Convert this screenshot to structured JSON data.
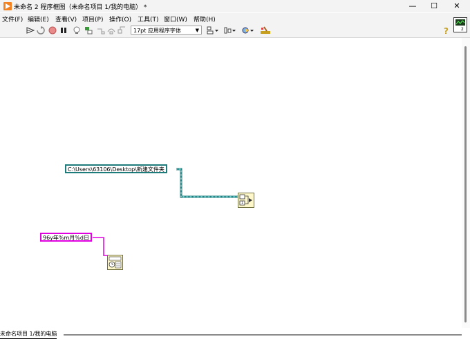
{
  "window": {
    "title": "未命名 2 程序框图（未命名项目 1/我的电脑）  *",
    "controls": {
      "minimize": "—",
      "maximize": "☐",
      "close": "✕"
    }
  },
  "menu": {
    "items": [
      {
        "label": "文件(F)"
      },
      {
        "label": "编辑(E)"
      },
      {
        "label": "查看(V)"
      },
      {
        "label": "项目(P)"
      },
      {
        "label": "操作(O)"
      },
      {
        "label": "工具(T)"
      },
      {
        "label": "窗口(W)"
      },
      {
        "label": "帮助(H)"
      }
    ]
  },
  "toolbar": {
    "font_select": "17pt 应用程序字体",
    "icons": [
      "run-arrow-icon",
      "run-continuously-icon",
      "abort-icon",
      "pause-icon",
      "highlight-execution-icon",
      "retain-wire-values-icon",
      "step-into-icon",
      "step-over-icon",
      "step-out-icon",
      "align-objects-icon",
      "distribute-objects-icon",
      "reorder-icon",
      "cleanup-diagram-icon",
      "context-help-icon"
    ]
  },
  "diagram": {
    "path_constant": "C:\\Users\\63106\\Desktop\\新建文件夹",
    "string_constant": "96y年%m月%d日",
    "path_wire_color": "#1e7b7b",
    "string_wire_color": "#e000e0"
  },
  "status": {
    "project": "未命名项目 1/我的电脑"
  }
}
